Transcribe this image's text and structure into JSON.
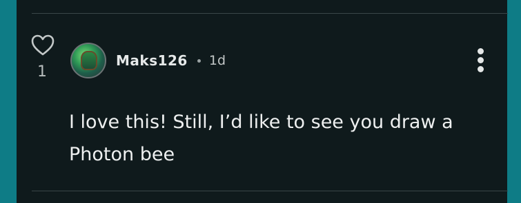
{
  "comment": {
    "like_count": "1",
    "username": "Maks126",
    "time_ago": "1d",
    "body": "I love this! Still, I’d like to see you draw a Photon bee"
  },
  "icons": {
    "like": "heart-outline-icon",
    "more": "more-vertical-icon"
  },
  "colors": {
    "background_edge": "#0e7c86",
    "panel": "#0f1a1c",
    "text": "#eef0f0",
    "muted_text": "#b8bdbd"
  }
}
